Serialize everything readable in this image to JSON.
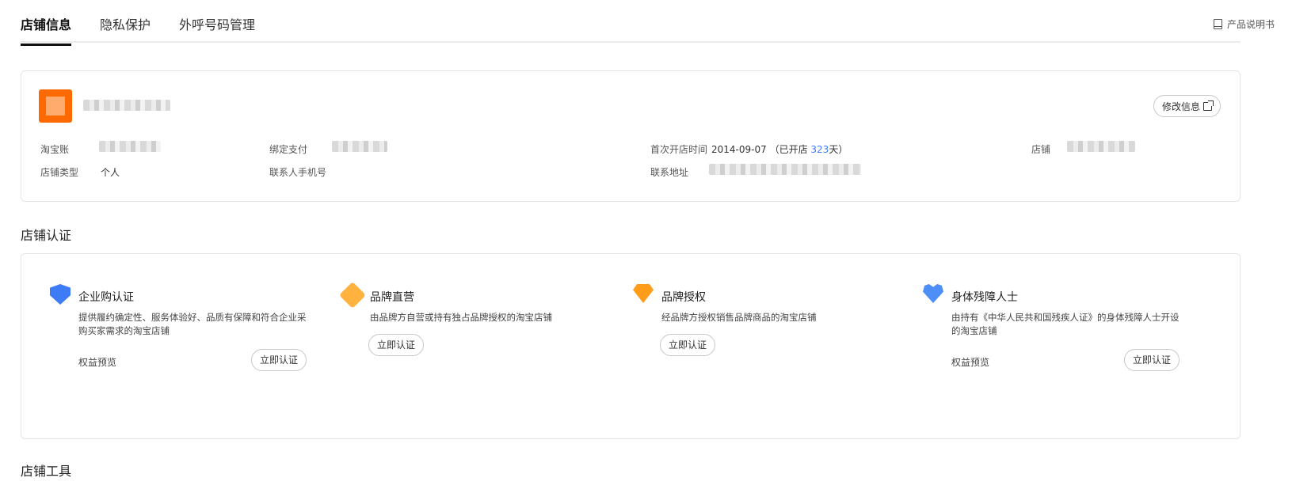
{
  "tabs": [
    {
      "label": "店铺信息",
      "active": true
    },
    {
      "label": "隐私保护",
      "active": false
    },
    {
      "label": "外呼号码管理",
      "active": false
    }
  ],
  "doc_link": {
    "label": "产品说明书",
    "icon": "book-icon"
  },
  "store_info": {
    "edit_label": "修改信息",
    "fields": {
      "taobao_account_label": "淘宝账",
      "alipay_label": "绑定支付",
      "first_open_label": "首次开店时间",
      "first_open_date": "2014-09-07",
      "open_days_prefix": "（已开店 ",
      "open_days": "323",
      "open_days_suffix": "天）",
      "shop_label": "店铺",
      "shop_type_label": "店铺类型",
      "shop_type_value": "个人",
      "contact_phone_label": "联系人手机号",
      "contact_address_label": "联系地址"
    }
  },
  "certification": {
    "section_title": "店铺认证",
    "items": [
      {
        "title": "企业购认证",
        "icon": "shield-check-icon",
        "desc": "提供履约确定性、服务体验好、品质有保障和符合企业采购买家需求的淘宝店铺",
        "rights": "权益预览",
        "button": "立即认证"
      },
      {
        "title": "品牌直营",
        "icon": "tag-icon",
        "desc": "由品牌方自营或持有独占品牌授权的淘宝店铺",
        "rights": "",
        "button": "立即认证"
      },
      {
        "title": "品牌授权",
        "icon": "diamond-icon",
        "desc": "经品牌方授权销售品牌商品的淘宝店铺",
        "rights": "",
        "button": "立即认证"
      },
      {
        "title": "身体残障人士",
        "icon": "heart-accessibility-icon",
        "desc": "由持有《中华人民共和国残疾人证》的身体残障人士开设的淘宝店铺",
        "rights": "权益预览",
        "button": "立即认证"
      }
    ]
  },
  "footer_section_title": "店铺工具",
  "colors": {
    "brand": "#ff6a00",
    "accent": "#3d7bf7"
  }
}
